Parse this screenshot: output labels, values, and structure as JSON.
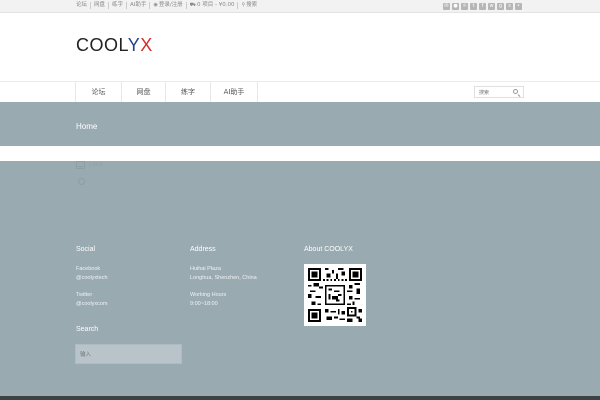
{
  "topbar": {
    "nav": [
      {
        "label": "论坛"
      },
      {
        "label": "网盘"
      },
      {
        "label": "练字"
      },
      {
        "label": "AI助手"
      },
      {
        "label": "登录/注册",
        "icon": "user-icon"
      },
      {
        "label": "0 项目 - ¥0.00",
        "icon": "cart-icon"
      },
      {
        "label": "搜索",
        "icon": "search-icon"
      }
    ],
    "social_icons": [
      "envelope-icon",
      "android-icon",
      "rss-icon",
      "twitter-icon",
      "facebook-icon",
      "weibo-icon",
      "github-icon",
      "skype-icon",
      "flickr-icon"
    ]
  },
  "logo": {
    "part1": "COOL",
    "part2": "Y",
    "part3": "X"
  },
  "menu": {
    "items": [
      "论坛",
      "网盘",
      "练字",
      "AI助手"
    ],
    "search_placeholder": "搜索"
  },
  "page": {
    "title": "Home",
    "ghost_text": "Lists"
  },
  "footer": {
    "social": {
      "heading": "Social",
      "lines": [
        "Facebook",
        "@coolyxtech",
        "Twitter",
        "@coolyxcom"
      ]
    },
    "address": {
      "heading": "Address",
      "lines": [
        "Huihai Plaza",
        "Longhua, Shenzhen, China",
        "Working Hours",
        "9:00~18:00"
      ]
    },
    "about": {
      "heading": "About COOLYX"
    },
    "search": {
      "heading": "Search",
      "placeholder": "输入"
    }
  },
  "colors": {
    "accent_blue": "#2a3e8c",
    "accent_red": "#d62a2a",
    "footer_bg": "#9aaab1"
  }
}
